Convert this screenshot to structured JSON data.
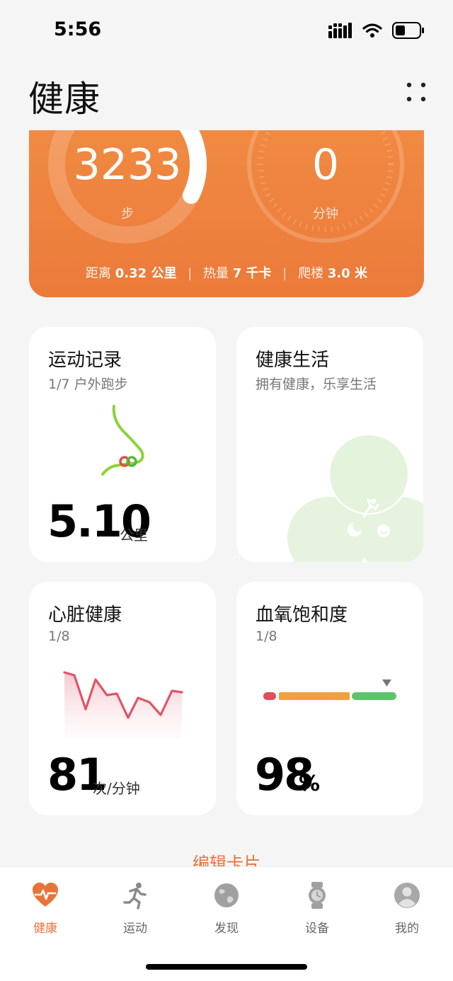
{
  "status_bar": {
    "time": "5:56"
  },
  "header": {
    "title": "健康"
  },
  "summary": {
    "steps_value": "3233",
    "steps_unit": "步",
    "minutes_value": "0",
    "minutes_unit": "分钟",
    "distance_label": "距离",
    "distance_value": "0.32 公里",
    "calories_label": "热量",
    "calories_value": "7 千卡",
    "floors_label": "爬楼",
    "floors_value": "3.0 米",
    "separator": "|"
  },
  "cards": {
    "exercise": {
      "title": "运动记录",
      "subtitle": "1/7 户外跑步",
      "value": "5.10",
      "unit": "公里"
    },
    "healthy_living": {
      "title": "健康生活",
      "subtitle": "拥有健康，乐享生活"
    },
    "heart": {
      "title": "心脏健康",
      "subtitle": "1/8",
      "value": "81",
      "unit": "次/分钟"
    },
    "spo2": {
      "title": "血氧饱和度",
      "subtitle": "1/8",
      "value": "98",
      "unit": "%"
    }
  },
  "edit_cards": "编辑卡片",
  "tabs": [
    {
      "label": "健康",
      "icon": "heart-pulse-icon",
      "active": true
    },
    {
      "label": "运动",
      "icon": "running-icon",
      "active": false
    },
    {
      "label": "发现",
      "icon": "globe-icon",
      "active": false
    },
    {
      "label": "设备",
      "icon": "watch-icon",
      "active": false
    },
    {
      "label": "我的",
      "icon": "profile-icon",
      "active": false
    }
  ],
  "colors": {
    "accent": "#e8743a",
    "summary_bg": "#ec7a3a",
    "heart_line": "#e05468",
    "spo2_red": "#e54b5a",
    "spo2_orange": "#f0a040",
    "spo2_green": "#5cc46a",
    "leaf_green": "#e4f3dc"
  }
}
